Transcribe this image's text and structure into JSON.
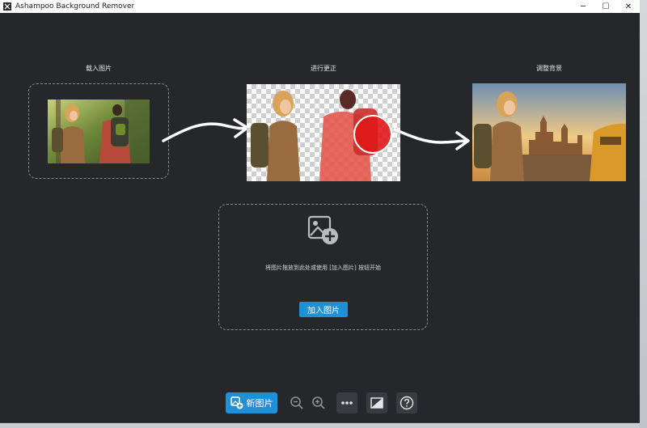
{
  "window": {
    "title": "Ashampoo Background Remover",
    "controls": {
      "minimize": "─",
      "maximize": "☐",
      "close": "✕"
    }
  },
  "steps": [
    {
      "label": "载入图片"
    },
    {
      "label": "进行更正"
    },
    {
      "label": "调整背景"
    }
  ],
  "dropzone": {
    "hint": "将图片拖放到此处或使用 [加入图片] 按钮开始",
    "add_button_label": "加入图片",
    "icon": "add-image-icon"
  },
  "toolbar": {
    "new_image_label": "新图片",
    "icons": [
      "new-image-icon",
      "zoom-out-icon",
      "zoom-in-icon",
      "more-icon",
      "compare-icon",
      "help-icon"
    ]
  },
  "colors": {
    "background": "#26272b",
    "accent": "#1e90d8",
    "dash": "#8a8b8f",
    "highlight_red": "#e02020"
  }
}
